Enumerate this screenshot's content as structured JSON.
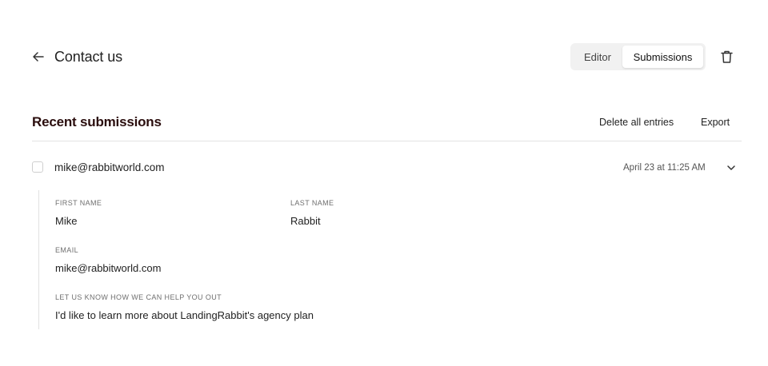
{
  "header": {
    "title": "Contact us",
    "tabs": [
      {
        "label": "Editor",
        "active": false
      },
      {
        "label": "Submissions",
        "active": true
      }
    ]
  },
  "section": {
    "title": "Recent submissions",
    "delete_all_label": "Delete all entries",
    "export_label": "Export"
  },
  "submission": {
    "email": "mike@rabbitworld.com",
    "date": "April 23 at 11:25 AM",
    "fields": {
      "first_name_label": "FIRST NAME",
      "first_name": "Mike",
      "last_name_label": "LAST NAME",
      "last_name": "Rabbit",
      "email_label": "EMAIL",
      "email": "mike@rabbitworld.com",
      "help_label": "LET US KNOW HOW WE CAN HELP YOU OUT",
      "help": "I'd like to learn more about LandingRabbit's agency plan"
    }
  },
  "icons": {
    "back": "arrow-left-icon",
    "trash": "trash-icon",
    "expand": "chevron-down-icon"
  },
  "colors": {
    "section_title": "#2a0d0d",
    "toggle_bg": "#f1f1f1"
  }
}
